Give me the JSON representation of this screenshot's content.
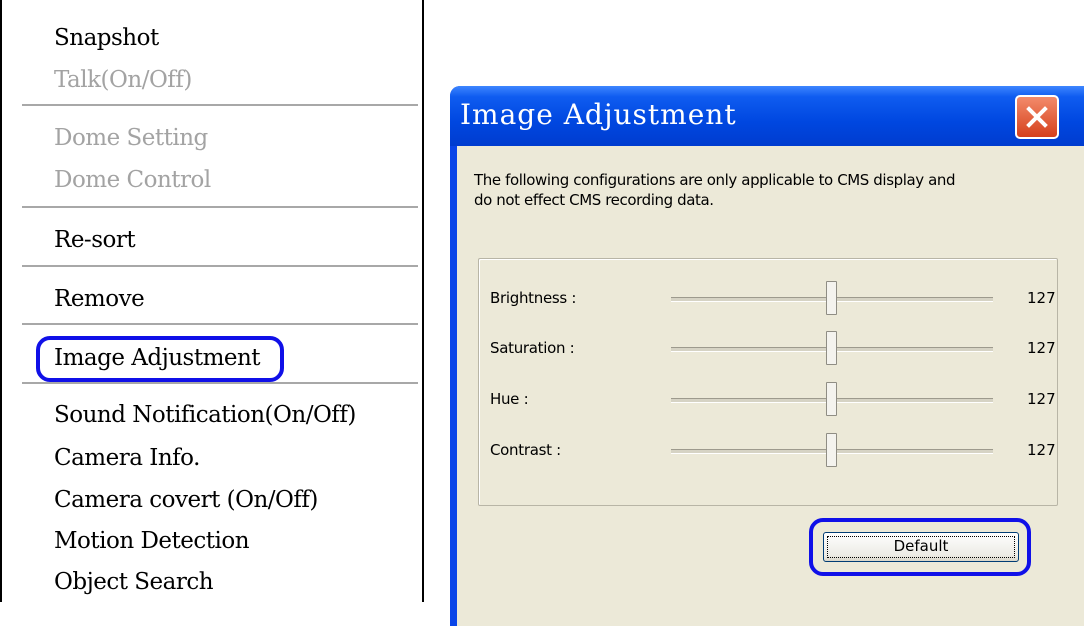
{
  "context_menu": {
    "items": [
      {
        "label": "Snapshot",
        "enabled": true
      },
      {
        "label": "Talk(On/Off)",
        "enabled": false
      },
      {
        "label": "Dome Setting",
        "enabled": false
      },
      {
        "label": "Dome Control",
        "enabled": false
      },
      {
        "label": "Re-sort",
        "enabled": true
      },
      {
        "label": "Remove",
        "enabled": true
      },
      {
        "label": "Image Adjustment",
        "enabled": true,
        "highlighted": true
      },
      {
        "label": "Sound Notification(On/Off)",
        "enabled": true
      },
      {
        "label": "Camera Info.",
        "enabled": true
      },
      {
        "label": "Camera covert (On/Off)",
        "enabled": true
      },
      {
        "label": "Motion Detection",
        "enabled": true
      },
      {
        "label": "Object Search",
        "enabled": true
      }
    ]
  },
  "dialog": {
    "title": "Image Adjustment",
    "description_line1": "The following configurations are only applicable to CMS display and",
    "description_line2": "do not effect CMS recording data.",
    "sliders": [
      {
        "label": "Brightness :",
        "value": "127",
        "level": 127,
        "min": 0,
        "max": 255
      },
      {
        "label": "Saturation :",
        "value": "127",
        "level": 127,
        "min": 0,
        "max": 255
      },
      {
        "label": "Hue :",
        "value": "127",
        "level": 127,
        "min": 0,
        "max": 255
      },
      {
        "label": "Contrast :",
        "value": "127",
        "level": 127,
        "min": 0,
        "max": 255
      }
    ],
    "default_button": "Default"
  },
  "colors": {
    "highlight_ring": "#1010e8",
    "titlebar": "#0047e0",
    "dialog_face": "#ece9d8",
    "disabled_text": "#a3a3a3"
  },
  "icons": {
    "close": "close-x-icon"
  }
}
